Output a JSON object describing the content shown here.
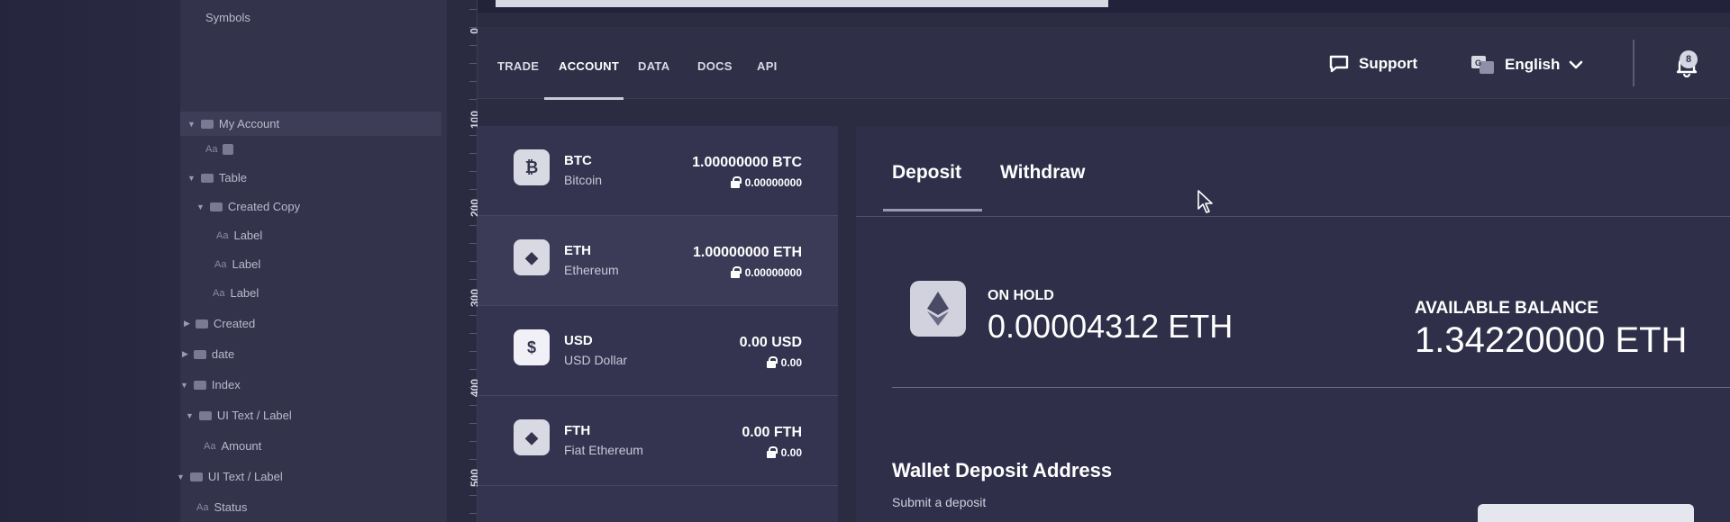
{
  "tree": {
    "items": [
      {
        "label": "Symbols",
        "kind": "plain"
      },
      {
        "label": "My Account",
        "kind": "folder",
        "selected": true
      },
      {
        "label": "Table",
        "kind": "folder"
      },
      {
        "label": "Created Copy",
        "kind": "folder"
      },
      {
        "label": "Label",
        "kind": "text"
      },
      {
        "label": "Label",
        "kind": "text"
      },
      {
        "label": "Label",
        "kind": "text"
      },
      {
        "label": "Created",
        "kind": "folder"
      },
      {
        "label": "date",
        "kind": "folder"
      },
      {
        "label": "Index",
        "kind": "folder"
      },
      {
        "label": "UI Text / Label",
        "kind": "folder"
      },
      {
        "label": "Amount",
        "kind": "text"
      },
      {
        "label": "UI Text / Label",
        "kind": "folder"
      },
      {
        "label": "Status",
        "kind": "text"
      }
    ],
    "text_prefix": "Aa"
  },
  "ruler": {
    "ticks": [
      "0",
      "100",
      "200",
      "300",
      "400",
      "500"
    ]
  },
  "nav": {
    "tabs": [
      "TRADE",
      "ACCOUNT",
      "DATA",
      "DOCS",
      "API"
    ],
    "active_tab": "ACCOUNT",
    "support_label": "Support",
    "language_label": "English",
    "notification_count": "8"
  },
  "assets": [
    {
      "symbol": "BTC",
      "name": "Bitcoin",
      "amount": "1.00000000 BTC",
      "on_hold": "0.00000000",
      "icon": "bitcoin-icon",
      "glyph": "₿"
    },
    {
      "symbol": "ETH",
      "name": "Ethereum",
      "amount": "1.00000000 ETH",
      "on_hold": "0.00000000",
      "icon": "ethereum-icon",
      "glyph": "◆",
      "selected": true
    },
    {
      "symbol": "USD",
      "name": "USD Dollar",
      "amount": "0.00 USD",
      "on_hold": "0.00",
      "icon": "dollar-icon",
      "glyph": "$"
    },
    {
      "symbol": "FTH",
      "name": "Fiat Ethereum",
      "amount": "0.00 FTH",
      "on_hold": "0.00",
      "icon": "ethereum-icon",
      "glyph": "◆"
    }
  ],
  "main": {
    "tabs": [
      "Deposit",
      "Withdraw"
    ],
    "active_tab": "Deposit",
    "on_hold_label": "ON HOLD",
    "on_hold_value": "0.00004312 ETH",
    "available_label": "AVAILABLE BALANCE",
    "available_value": "1.34220000 ETH",
    "wallet_title": "Wallet Deposit Address",
    "wallet_subtitle": "Submit a deposit"
  },
  "colors": {
    "background": "#2b2b42",
    "panel": "#343450",
    "accent": "#ffffff"
  }
}
